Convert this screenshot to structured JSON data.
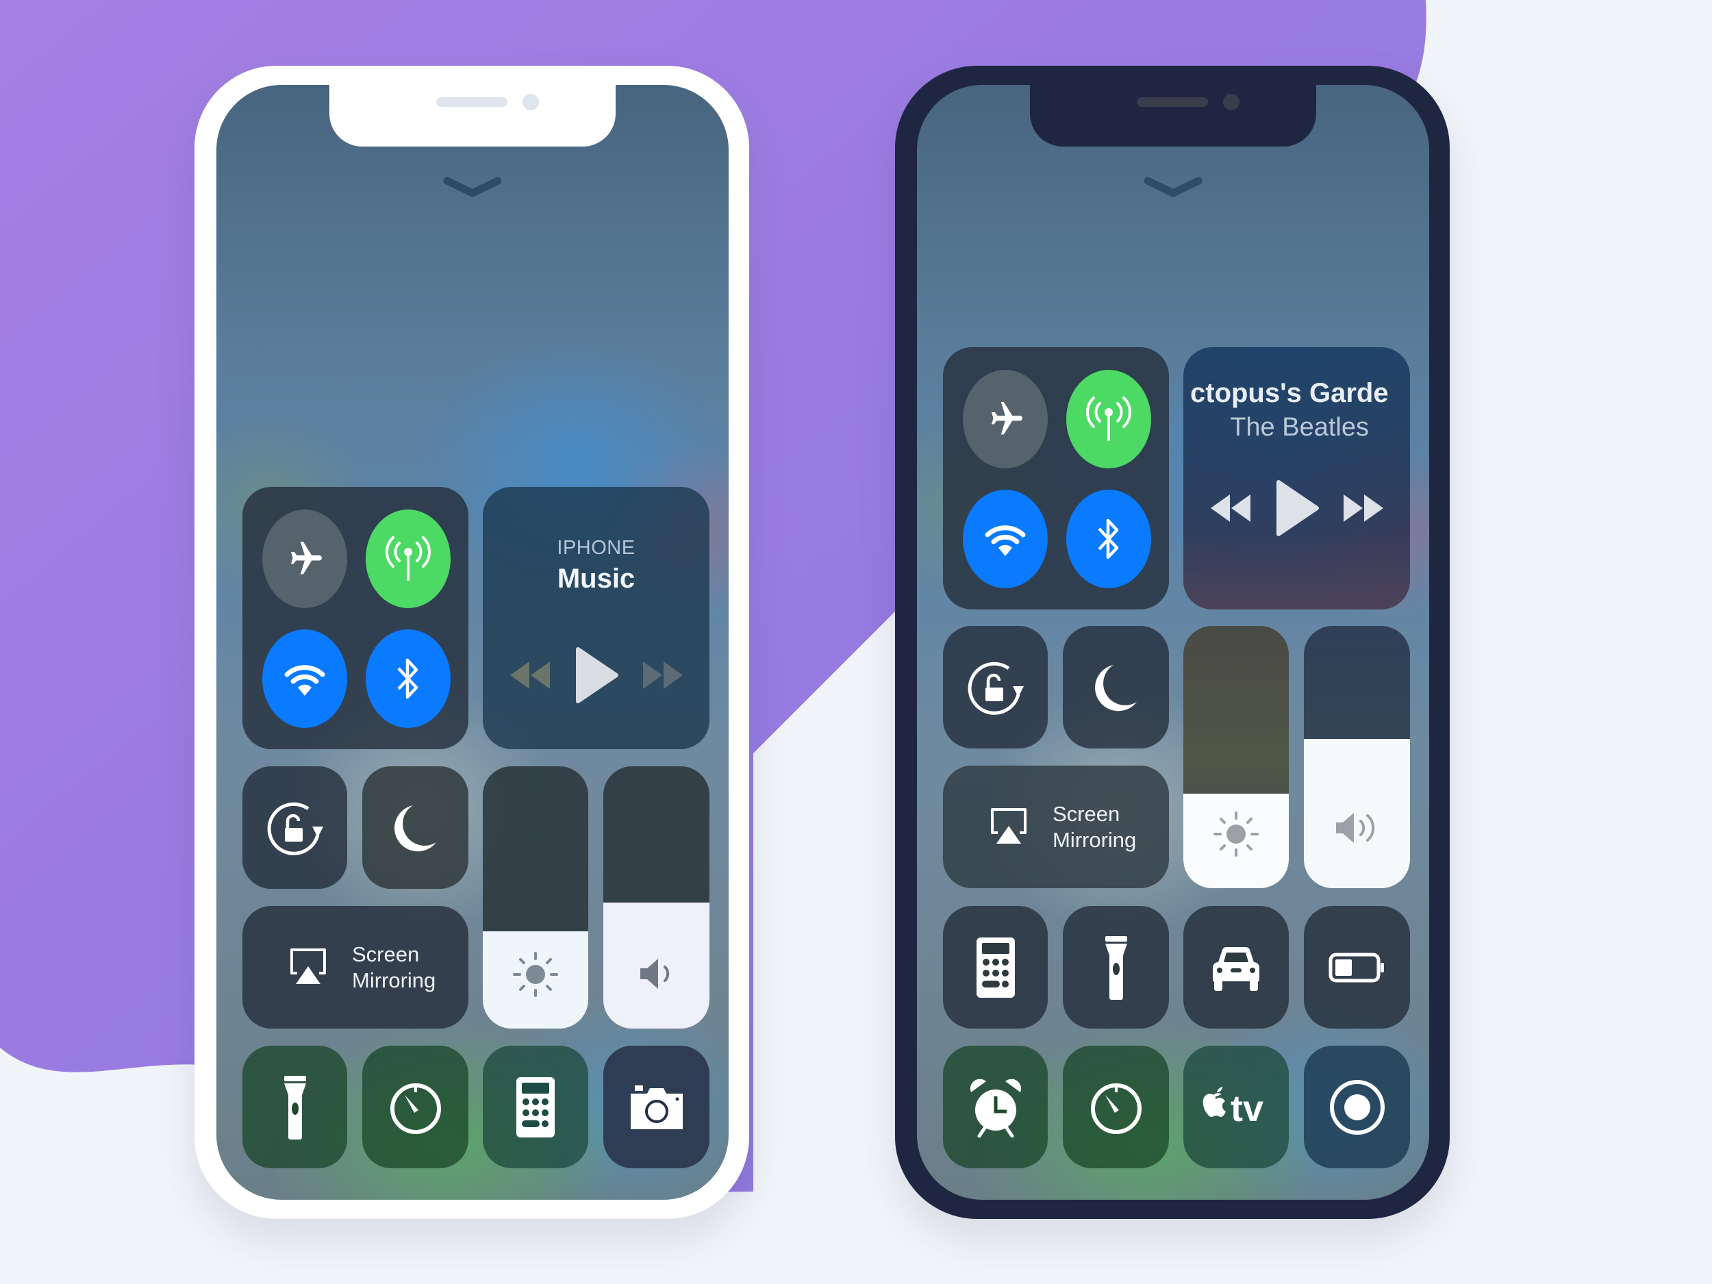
{
  "background": {
    "accent": "#9b7de0",
    "page": "#f1f4f9"
  },
  "phones": [
    {
      "variant": "white",
      "frame_color": "#ffffff",
      "connectivity": {
        "airplane": {
          "label": "Airplane Mode",
          "state": "off",
          "color": "#5b6670"
        },
        "cellular": {
          "label": "Cellular Data",
          "state": "on",
          "color": "#4cd964"
        },
        "wifi": {
          "label": "Wi-Fi",
          "state": "on",
          "color": "#0a7aff"
        },
        "bluetooth": {
          "label": "Bluetooth",
          "state": "on",
          "color": "#0a7aff"
        }
      },
      "music": {
        "source": "IPHONE",
        "title": "Music",
        "controls": [
          "rewind",
          "play",
          "fast-forward"
        ],
        "controls_enabled": false
      },
      "toggles": [
        {
          "label": "Orientation Lock",
          "icon": "rotation-lock-icon"
        },
        {
          "label": "Do Not Disturb",
          "icon": "moon-icon"
        }
      ],
      "screen_mirroring": {
        "line1": "Screen",
        "line2": "Mirroring"
      },
      "brightness": {
        "label": "Brightness",
        "level": 0.37
      },
      "volume": {
        "label": "Volume",
        "level": 0.48
      },
      "shortcuts": [
        {
          "label": "Flashlight",
          "icon": "flashlight-icon"
        },
        {
          "label": "Timer",
          "icon": "timer-icon"
        },
        {
          "label": "Calculator",
          "icon": "calculator-icon"
        },
        {
          "label": "Camera",
          "icon": "camera-icon"
        }
      ]
    },
    {
      "variant": "dark",
      "frame_color": "#1f2642",
      "connectivity": {
        "airplane": {
          "label": "Airplane Mode",
          "state": "off",
          "color": "#5b6670"
        },
        "cellular": {
          "label": "Cellular Data",
          "state": "on",
          "color": "#4cd964"
        },
        "wifi": {
          "label": "Wi-Fi",
          "state": "on",
          "color": "#0a7aff"
        },
        "bluetooth": {
          "label": "Bluetooth",
          "state": "on",
          "color": "#0a7aff"
        }
      },
      "music": {
        "title": "ctopus's Garden",
        "artist": "The Beatles",
        "controls": [
          "rewind",
          "play",
          "fast-forward"
        ],
        "controls_enabled": true
      },
      "toggles": [
        {
          "label": "Orientation Lock",
          "icon": "rotation-lock-icon"
        },
        {
          "label": "Do Not Disturb",
          "icon": "moon-icon"
        }
      ],
      "screen_mirroring": {
        "line1": "Screen",
        "line2": "Mirroring"
      },
      "brightness": {
        "label": "Brightness",
        "level": 0.36
      },
      "volume": {
        "label": "Volume",
        "level": 0.57
      },
      "shortcuts": [
        {
          "label": "Calculator",
          "icon": "calculator-icon"
        },
        {
          "label": "Flashlight",
          "icon": "flashlight-icon"
        },
        {
          "label": "Do Not Disturb While Driving",
          "icon": "car-icon"
        },
        {
          "label": "Low Power Mode",
          "icon": "battery-icon"
        },
        {
          "label": "Alarm",
          "icon": "alarm-clock-icon"
        },
        {
          "label": "Timer",
          "icon": "timer-icon"
        },
        {
          "label": "Apple TV Remote",
          "icon": "apple-tv-icon"
        },
        {
          "label": "Screen Recording",
          "icon": "screen-record-icon"
        }
      ]
    }
  ]
}
